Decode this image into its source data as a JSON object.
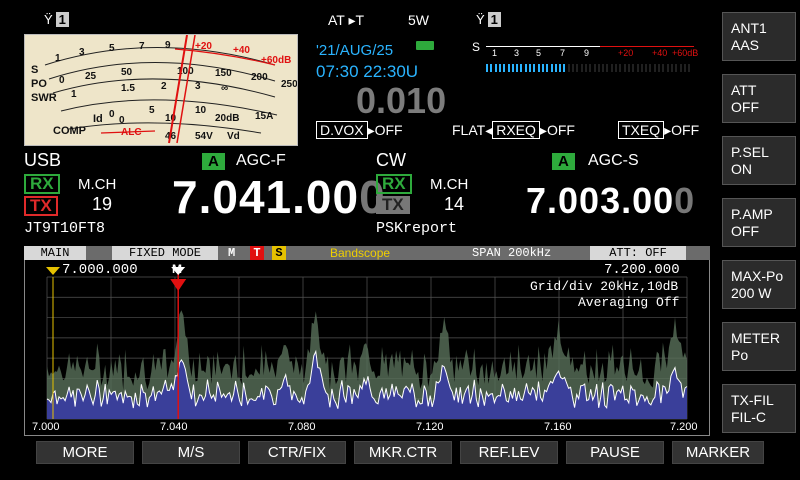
{
  "header": {
    "ant_left_num": "1",
    "at_label": "AT ▸T",
    "power": "5W",
    "ant_right_num": "1",
    "date": "'21/AUG/25",
    "time": "07:30 22:30U",
    "offset": "0.010"
  },
  "smeter": {
    "scale_s": "S",
    "ticks": [
      "1",
      "3",
      "5",
      "7",
      "9",
      "+20",
      "+40",
      "+60dB"
    ],
    "level": 0.4
  },
  "analog_meter": {
    "row_labels": [
      "S",
      "PO",
      "SWR",
      "Id",
      "COMP"
    ],
    "s_scale": [
      "1",
      "3",
      "5",
      "7",
      "9",
      "+20",
      "+40",
      "+60dB"
    ],
    "po_scale": [
      "0",
      "25",
      "50",
      "100",
      "150",
      "200",
      "250W"
    ],
    "swr_scale": [
      "1",
      "1.5",
      "2",
      "3",
      "∞"
    ],
    "id_scale": [
      "0",
      "5",
      "10",
      "15A"
    ],
    "comp_scale": [
      "0",
      "10",
      "20dB"
    ],
    "alc_label": "ALC",
    "vd_scale": [
      "46",
      "54V",
      "Vd"
    ]
  },
  "status_row": {
    "dvox": "D.VOX",
    "dvox_val": "OFF",
    "flat": "FLAT",
    "rxeq": "RXEQ",
    "rxeq_val": "OFF",
    "txeq": "TXEQ",
    "txeq_val": "OFF"
  },
  "vfo_a": {
    "mode": "USB",
    "badge": "A",
    "agc": "AGC-F",
    "rx": "RX",
    "tx": "TX",
    "mch": "M.CH",
    "ch": "19",
    "freq": "7.041.00",
    "freq_last": "0",
    "memo": "JT9T10FT8"
  },
  "vfo_b": {
    "mode": "CW",
    "badge": "A",
    "agc": "AGC-S",
    "rx": "RX",
    "tx": "TX",
    "mch": "M.CH",
    "ch": "14",
    "freq": "7.003.00",
    "freq_last": "0",
    "memo": "PSKreport"
  },
  "bandscope": {
    "main": "MAIN",
    "mode": "FIXED MODE",
    "m": "M",
    "t": "T",
    "s": "S",
    "title": "Bandscope",
    "span": "SPAN 200kHz",
    "att": "ATT: OFF",
    "start": "7.000.000",
    "end": "7.200.000",
    "marker": "M",
    "grid": "Grid/div 20kHz,10dB",
    "averaging": "Averaging Off",
    "xticks": [
      "7.000",
      "7.040",
      "7.080",
      "7.120",
      "7.160",
      "7.200"
    ]
  },
  "side_buttons": [
    {
      "l1": "ANT1",
      "l2": "AAS"
    },
    {
      "l1": "ATT",
      "l2": "OFF"
    },
    {
      "l1": "P.SEL",
      "l2": " ON"
    },
    {
      "l1": "P.AMP",
      "l2": "OFF"
    },
    {
      "l1": "MAX-Po",
      "l2": "200 W"
    },
    {
      "l1": "METER",
      "l2": "Po"
    },
    {
      "l1": "TX-FIL",
      "l2": "FIL-C"
    }
  ],
  "bottom_buttons": [
    "MORE",
    "M/S",
    "CTR/FIX",
    "MKR.CTR",
    "REF.LEV",
    "PAUSE",
    "MARKER"
  ],
  "colors": {
    "accent_cyan": "#2ab4ff",
    "rx_green": "#2eaa3c",
    "tx_red": "#e02a2a",
    "marker_red": "#e01010",
    "scope_fill": "#3a3f9a",
    "scope_hist": "#59705a"
  }
}
